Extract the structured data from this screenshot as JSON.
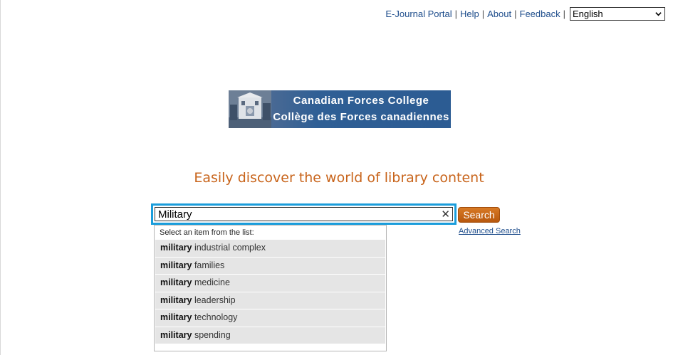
{
  "nav": {
    "links": [
      "E-Journal Portal",
      "Help",
      "About",
      "Feedback"
    ],
    "separator": "|",
    "language": "English"
  },
  "logo": {
    "line1": "Canadian Forces College",
    "line2": "Collège des Forces canadiennes"
  },
  "tagline": "Easily discover the world of library content",
  "search": {
    "value": "Military",
    "button_label": "Search",
    "advanced_label": "Advanced Search"
  },
  "suggestions": {
    "hint": "Select an item from the list:",
    "items": [
      {
        "bold": "military",
        "rest": " industrial complex"
      },
      {
        "bold": "military",
        "rest": " families"
      },
      {
        "bold": "military",
        "rest": " medicine"
      },
      {
        "bold": "military",
        "rest": " leadership"
      },
      {
        "bold": "military",
        "rest": " technology"
      },
      {
        "bold": "military",
        "rest": " spending"
      }
    ]
  },
  "colors": {
    "accent_orange": "#c8641b",
    "focus_blue": "#1a9ddb",
    "link_blue": "#1f4e8c"
  }
}
